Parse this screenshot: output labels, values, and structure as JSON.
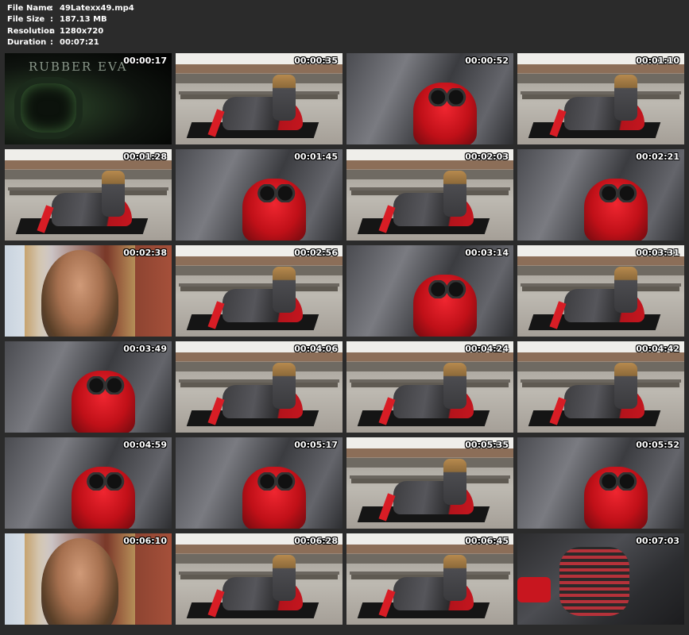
{
  "file_info": {
    "rows": [
      {
        "label": "File Name",
        "sep": ":",
        "value": "49Latexx49.mp4"
      },
      {
        "label": "File Size",
        "sep": ":",
        "value": "187.13 MB"
      },
      {
        "label": "Resolution",
        "sep": ":",
        "value": "1280x720"
      },
      {
        "label": "Duration",
        "sep": ":",
        "value": "00:07:21"
      }
    ]
  },
  "thumbnails": [
    {
      "time": "00:00:17",
      "scene": "intro",
      "brand": "RUBBER EVA"
    },
    {
      "time": "00:00:35",
      "scene": "outdoor"
    },
    {
      "time": "00:00:52",
      "scene": "closeup"
    },
    {
      "time": "00:01:10",
      "scene": "outdoor"
    },
    {
      "time": "00:01:28",
      "scene": "outdoor"
    },
    {
      "time": "00:01:45",
      "scene": "closeup"
    },
    {
      "time": "00:02:03",
      "scene": "outdoor"
    },
    {
      "time": "00:02:21",
      "scene": "closeup"
    },
    {
      "time": "00:02:38",
      "scene": "face"
    },
    {
      "time": "00:02:56",
      "scene": "outdoor"
    },
    {
      "time": "00:03:14",
      "scene": "closeup"
    },
    {
      "time": "00:03:31",
      "scene": "outdoor"
    },
    {
      "time": "00:03:49",
      "scene": "closeup"
    },
    {
      "time": "00:04:06",
      "scene": "outdoor"
    },
    {
      "time": "00:04:24",
      "scene": "outdoor"
    },
    {
      "time": "00:04:42",
      "scene": "outdoor"
    },
    {
      "time": "00:04:59",
      "scene": "closeup"
    },
    {
      "time": "00:05:17",
      "scene": "closeup"
    },
    {
      "time": "00:05:35",
      "scene": "outdoor"
    },
    {
      "time": "00:05:52",
      "scene": "closeup"
    },
    {
      "time": "00:06:10",
      "scene": "face"
    },
    {
      "time": "00:06:28",
      "scene": "outdoor"
    },
    {
      "time": "00:06:45",
      "scene": "outdoor"
    },
    {
      "time": "00:07:03",
      "scene": "detail"
    }
  ]
}
